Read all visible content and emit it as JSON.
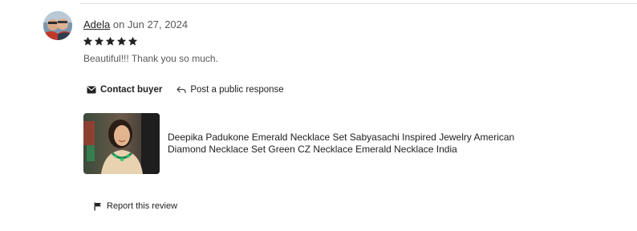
{
  "review": {
    "author": "Adela",
    "date_text": " on Jun 27, 2024",
    "rating": 5,
    "rating_max": 5,
    "text": "Beautiful!!! Thank you so much."
  },
  "actions": {
    "contact_label": "Contact buyer",
    "public_response_label": "Post a public response"
  },
  "listing": {
    "title": "Deepika Padukone Emerald Necklace Set Sabyasachi Inspired Jewelry American Diamond Necklace Set Green CZ Necklace Emerald Necklace India"
  },
  "footer": {
    "report_label": "Report this review"
  },
  "icons": {
    "contact": "envelope-icon",
    "public_response": "reply-arrow-icon",
    "report": "flag-icon",
    "star": "star-icon"
  },
  "colors": {
    "star": "#222222",
    "muted_text": "#595959",
    "divider": "#e1e3df"
  }
}
